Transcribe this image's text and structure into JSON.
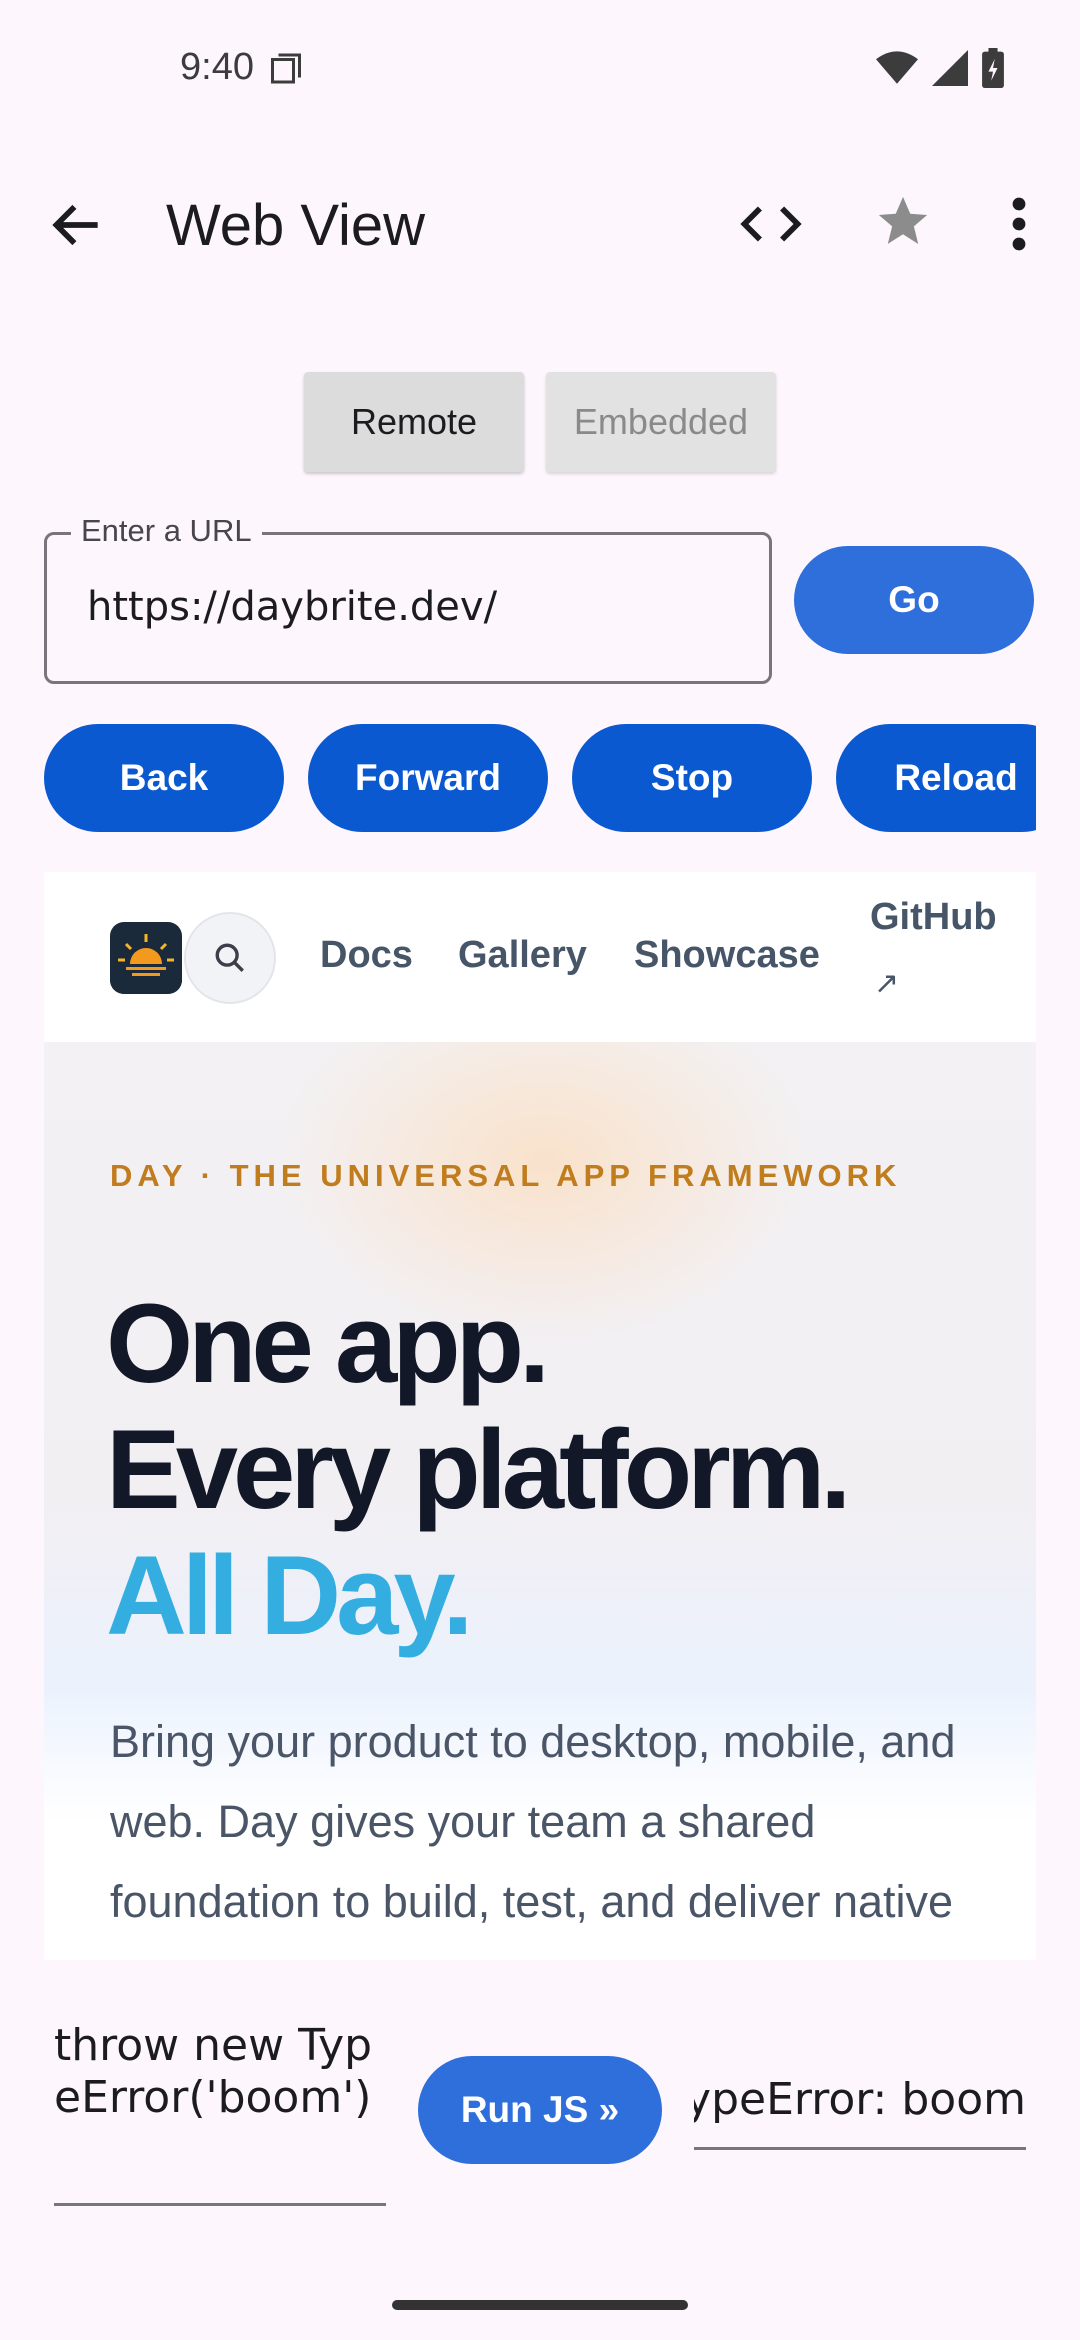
{
  "status": {
    "time": "9:40"
  },
  "app_bar": {
    "title": "Web View"
  },
  "segments": {
    "remote": "Remote",
    "embedded": "Embedded"
  },
  "url": {
    "label": "Enter a URL",
    "value": "https://daybrite.dev/"
  },
  "buttons": {
    "go": "Go",
    "back": "Back",
    "forward": "Forward",
    "stop": "Stop",
    "reload": "Reload",
    "run_js": "Run JS »"
  },
  "site": {
    "nav": {
      "docs": "Docs",
      "gallery": "Gallery",
      "showcase": "Showcase",
      "github": "GitHub",
      "github_arrow": "↗"
    },
    "eyebrow": "DAY · THE UNIVERSAL APP FRAMEWORK",
    "headline": [
      "One app.",
      "Every platform.",
      "All Day."
    ],
    "body": "Bring your product to desktop, mobile, and web. Day gives your team a shared foundation to build, test, and deliver native apps across the consumer"
  },
  "js": {
    "input": "throw new TypeError('boom')",
    "output": "TypeError: boom"
  },
  "colors": {
    "primary": "#2f6fdc",
    "nav_button": "#0b59d0",
    "accent_blue": "#34aee0",
    "eyebrow": "#c07c1d"
  }
}
